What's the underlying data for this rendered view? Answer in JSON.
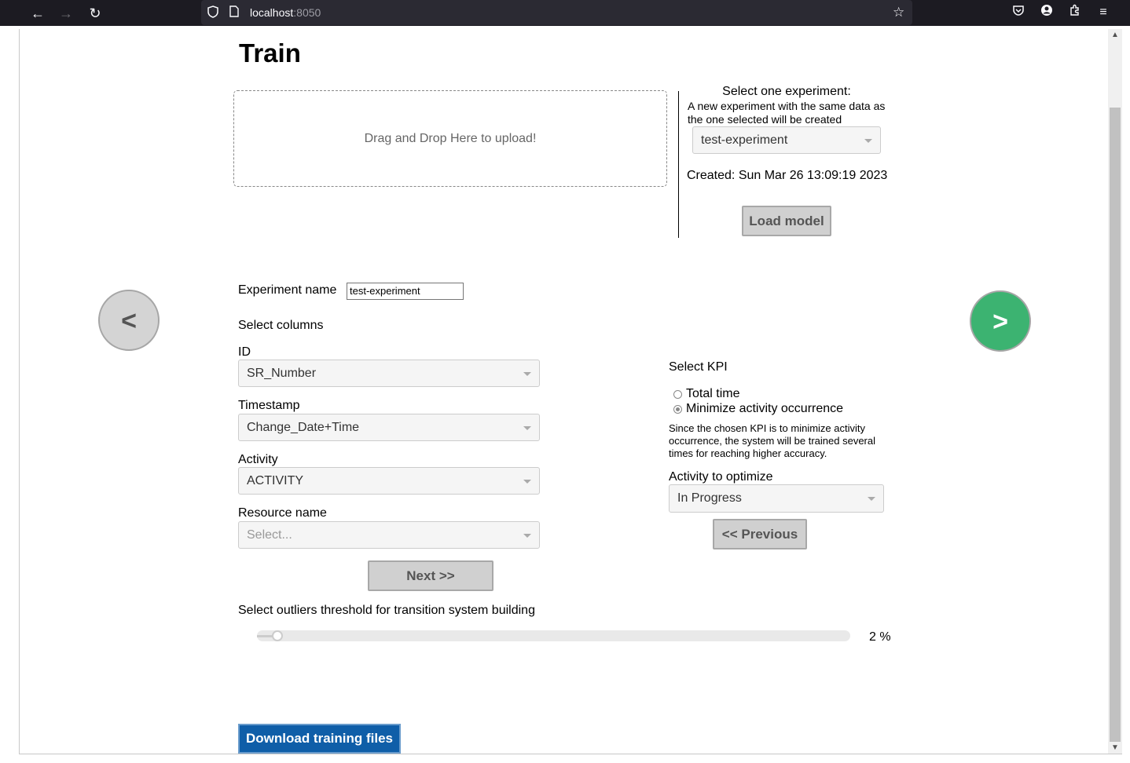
{
  "browser": {
    "url_host": "localhost",
    "url_port": ":8050"
  },
  "page": {
    "title": "Train",
    "dropzone_text": "Drag and Drop Here to upload!",
    "experiment": {
      "heading": "Select one experiment:",
      "note": "A new experiment with the same data as the one selected will be created",
      "selected": "test-experiment",
      "created": "Created: Sun Mar 26 13:09:19 2023",
      "load_button": "Load model"
    },
    "nav": {
      "prev": "<",
      "next": ">"
    },
    "experiment_name": {
      "label": "Experiment name",
      "value": "test-experiment"
    },
    "columns": {
      "heading": "Select columns",
      "id_label": "ID",
      "id_value": "SR_Number",
      "timestamp_label": "Timestamp",
      "timestamp_value": "Change_Date+Time",
      "activity_label": "Activity",
      "activity_value": "ACTIVITY",
      "resource_label": "Resource name",
      "resource_placeholder": "Select...",
      "next_button": "Next >>"
    },
    "kpi": {
      "heading": "Select KPI",
      "options": [
        "Total time",
        "Minimize activity occurrence"
      ],
      "selected_index": 1,
      "note": "Since the chosen KPI is to minimize activity occurrence, the system will be trained several times for reaching higher accuracy.",
      "activity_label": "Activity to optimize",
      "activity_value": "In Progress",
      "previous_button": "<< Previous"
    },
    "outliers": {
      "label": "Select outliers threshold for transition system building",
      "value_percent": 2,
      "value_text": "2 %"
    },
    "download_button": "Download training files"
  }
}
